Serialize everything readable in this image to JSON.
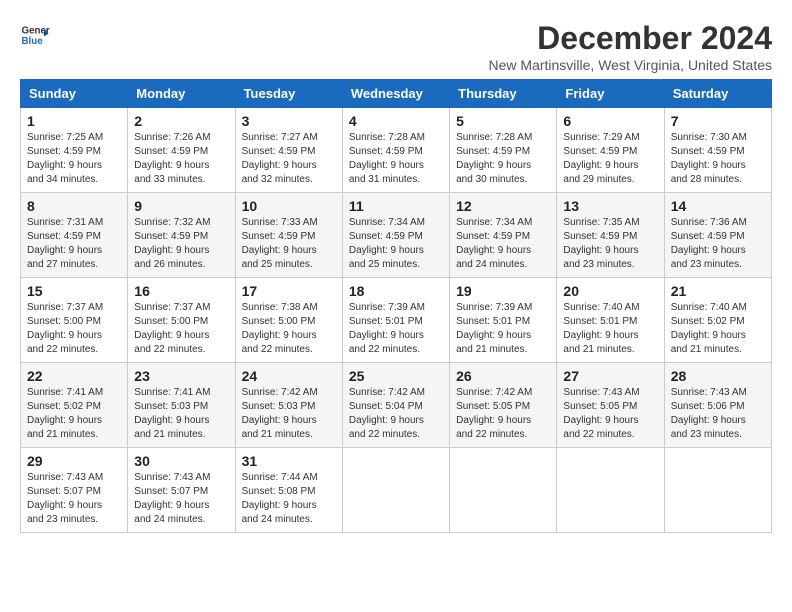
{
  "header": {
    "logo_line1": "General",
    "logo_line2": "Blue",
    "month_year": "December 2024",
    "location": "New Martinsville, West Virginia, United States"
  },
  "days_of_week": [
    "Sunday",
    "Monday",
    "Tuesday",
    "Wednesday",
    "Thursday",
    "Friday",
    "Saturday"
  ],
  "weeks": [
    [
      {
        "day": "1",
        "sunrise": "Sunrise: 7:25 AM",
        "sunset": "Sunset: 4:59 PM",
        "daylight": "Daylight: 9 hours and 34 minutes."
      },
      {
        "day": "2",
        "sunrise": "Sunrise: 7:26 AM",
        "sunset": "Sunset: 4:59 PM",
        "daylight": "Daylight: 9 hours and 33 minutes."
      },
      {
        "day": "3",
        "sunrise": "Sunrise: 7:27 AM",
        "sunset": "Sunset: 4:59 PM",
        "daylight": "Daylight: 9 hours and 32 minutes."
      },
      {
        "day": "4",
        "sunrise": "Sunrise: 7:28 AM",
        "sunset": "Sunset: 4:59 PM",
        "daylight": "Daylight: 9 hours and 31 minutes."
      },
      {
        "day": "5",
        "sunrise": "Sunrise: 7:28 AM",
        "sunset": "Sunset: 4:59 PM",
        "daylight": "Daylight: 9 hours and 30 minutes."
      },
      {
        "day": "6",
        "sunrise": "Sunrise: 7:29 AM",
        "sunset": "Sunset: 4:59 PM",
        "daylight": "Daylight: 9 hours and 29 minutes."
      },
      {
        "day": "7",
        "sunrise": "Sunrise: 7:30 AM",
        "sunset": "Sunset: 4:59 PM",
        "daylight": "Daylight: 9 hours and 28 minutes."
      }
    ],
    [
      {
        "day": "8",
        "sunrise": "Sunrise: 7:31 AM",
        "sunset": "Sunset: 4:59 PM",
        "daylight": "Daylight: 9 hours and 27 minutes."
      },
      {
        "day": "9",
        "sunrise": "Sunrise: 7:32 AM",
        "sunset": "Sunset: 4:59 PM",
        "daylight": "Daylight: 9 hours and 26 minutes."
      },
      {
        "day": "10",
        "sunrise": "Sunrise: 7:33 AM",
        "sunset": "Sunset: 4:59 PM",
        "daylight": "Daylight: 9 hours and 25 minutes."
      },
      {
        "day": "11",
        "sunrise": "Sunrise: 7:34 AM",
        "sunset": "Sunset: 4:59 PM",
        "daylight": "Daylight: 9 hours and 25 minutes."
      },
      {
        "day": "12",
        "sunrise": "Sunrise: 7:34 AM",
        "sunset": "Sunset: 4:59 PM",
        "daylight": "Daylight: 9 hours and 24 minutes."
      },
      {
        "day": "13",
        "sunrise": "Sunrise: 7:35 AM",
        "sunset": "Sunset: 4:59 PM",
        "daylight": "Daylight: 9 hours and 23 minutes."
      },
      {
        "day": "14",
        "sunrise": "Sunrise: 7:36 AM",
        "sunset": "Sunset: 4:59 PM",
        "daylight": "Daylight: 9 hours and 23 minutes."
      }
    ],
    [
      {
        "day": "15",
        "sunrise": "Sunrise: 7:37 AM",
        "sunset": "Sunset: 5:00 PM",
        "daylight": "Daylight: 9 hours and 22 minutes."
      },
      {
        "day": "16",
        "sunrise": "Sunrise: 7:37 AM",
        "sunset": "Sunset: 5:00 PM",
        "daylight": "Daylight: 9 hours and 22 minutes."
      },
      {
        "day": "17",
        "sunrise": "Sunrise: 7:38 AM",
        "sunset": "Sunset: 5:00 PM",
        "daylight": "Daylight: 9 hours and 22 minutes."
      },
      {
        "day": "18",
        "sunrise": "Sunrise: 7:39 AM",
        "sunset": "Sunset: 5:01 PM",
        "daylight": "Daylight: 9 hours and 22 minutes."
      },
      {
        "day": "19",
        "sunrise": "Sunrise: 7:39 AM",
        "sunset": "Sunset: 5:01 PM",
        "daylight": "Daylight: 9 hours and 21 minutes."
      },
      {
        "day": "20",
        "sunrise": "Sunrise: 7:40 AM",
        "sunset": "Sunset: 5:01 PM",
        "daylight": "Daylight: 9 hours and 21 minutes."
      },
      {
        "day": "21",
        "sunrise": "Sunrise: 7:40 AM",
        "sunset": "Sunset: 5:02 PM",
        "daylight": "Daylight: 9 hours and 21 minutes."
      }
    ],
    [
      {
        "day": "22",
        "sunrise": "Sunrise: 7:41 AM",
        "sunset": "Sunset: 5:02 PM",
        "daylight": "Daylight: 9 hours and 21 minutes."
      },
      {
        "day": "23",
        "sunrise": "Sunrise: 7:41 AM",
        "sunset": "Sunset: 5:03 PM",
        "daylight": "Daylight: 9 hours and 21 minutes."
      },
      {
        "day": "24",
        "sunrise": "Sunrise: 7:42 AM",
        "sunset": "Sunset: 5:03 PM",
        "daylight": "Daylight: 9 hours and 21 minutes."
      },
      {
        "day": "25",
        "sunrise": "Sunrise: 7:42 AM",
        "sunset": "Sunset: 5:04 PM",
        "daylight": "Daylight: 9 hours and 22 minutes."
      },
      {
        "day": "26",
        "sunrise": "Sunrise: 7:42 AM",
        "sunset": "Sunset: 5:05 PM",
        "daylight": "Daylight: 9 hours and 22 minutes."
      },
      {
        "day": "27",
        "sunrise": "Sunrise: 7:43 AM",
        "sunset": "Sunset: 5:05 PM",
        "daylight": "Daylight: 9 hours and 22 minutes."
      },
      {
        "day": "28",
        "sunrise": "Sunrise: 7:43 AM",
        "sunset": "Sunset: 5:06 PM",
        "daylight": "Daylight: 9 hours and 23 minutes."
      }
    ],
    [
      {
        "day": "29",
        "sunrise": "Sunrise: 7:43 AM",
        "sunset": "Sunset: 5:07 PM",
        "daylight": "Daylight: 9 hours and 23 minutes."
      },
      {
        "day": "30",
        "sunrise": "Sunrise: 7:43 AM",
        "sunset": "Sunset: 5:07 PM",
        "daylight": "Daylight: 9 hours and 24 minutes."
      },
      {
        "day": "31",
        "sunrise": "Sunrise: 7:44 AM",
        "sunset": "Sunset: 5:08 PM",
        "daylight": "Daylight: 9 hours and 24 minutes."
      },
      null,
      null,
      null,
      null
    ]
  ]
}
